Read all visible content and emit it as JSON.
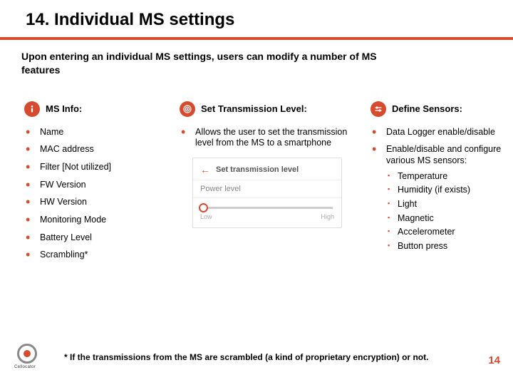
{
  "header": {
    "title": "14. Individual MS settings"
  },
  "intro": "Upon entering an individual MS settings, users can modify a number of MS features",
  "col1": {
    "title": "MS Info:",
    "items": [
      "Name",
      "MAC address",
      "Filter [Not utilized]",
      "FW Version",
      "HW Version",
      "Monitoring Mode",
      "Battery Level",
      "Scrambling*"
    ]
  },
  "col2": {
    "title": "Set Transmission Level:",
    "desc": "Allows the user to set the transmission level from the MS to a smartphone",
    "mock": {
      "title": "Set transmission level",
      "row": "Power level",
      "low": "Low",
      "high": "High"
    }
  },
  "col3": {
    "title": "Define Sensors:",
    "items": [
      "Data Logger enable/disable",
      "Enable/disable and configure various MS sensors:"
    ],
    "sensors": [
      "Temperature",
      "Humidity (if exists)",
      "Light",
      "Magnetic",
      "Accelerometer",
      "Button press"
    ]
  },
  "footnote": "* If the transmissions from the MS are scrambled (a kind of proprietary encryption) or not.",
  "page": "14",
  "logo": "Cellocator"
}
